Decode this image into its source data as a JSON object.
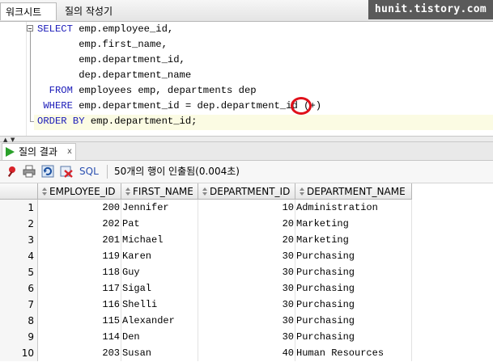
{
  "tabs": {
    "worksheet": "워크시트",
    "query_builder": "질의 작성기"
  },
  "watermark": "hunit.tistory.com",
  "editor": {
    "lines": [
      [
        {
          "t": "SELECT",
          "kw": true
        },
        {
          "t": " emp.employee_id,",
          "kw": false
        }
      ],
      [
        {
          "t": "       emp.first_name,",
          "kw": false
        }
      ],
      [
        {
          "t": "       emp.department_id,",
          "kw": false
        }
      ],
      [
        {
          "t": "       dep.department_name",
          "kw": false
        }
      ],
      [
        {
          "t": "  FROM",
          "kw": true
        },
        {
          "t": " employees emp, departments dep",
          "kw": false
        }
      ],
      [
        {
          "t": " WHERE",
          "kw": true
        },
        {
          "t": " emp.department_id = dep.department_id (+)",
          "kw": false
        }
      ],
      [
        {
          "t": "ORDER BY",
          "kw": true
        },
        {
          "t": " emp.department_id;",
          "kw": false
        }
      ]
    ]
  },
  "results_tab": {
    "label": "질의 결과",
    "close": "x"
  },
  "toolbar": {
    "sql_label": "SQL",
    "status": "50개의 행이 인출됨(0.004초)"
  },
  "grid": {
    "columns": [
      "EMPLOYEE_ID",
      "FIRST_NAME",
      "DEPARTMENT_ID",
      "DEPARTMENT_NAME"
    ],
    "rows": [
      {
        "n": "1",
        "employee_id": "200",
        "first_name": "Jennifer",
        "department_id": "10",
        "department_name": "Administration"
      },
      {
        "n": "2",
        "employee_id": "202",
        "first_name": "Pat",
        "department_id": "20",
        "department_name": "Marketing"
      },
      {
        "n": "3",
        "employee_id": "201",
        "first_name": "Michael",
        "department_id": "20",
        "department_name": "Marketing"
      },
      {
        "n": "4",
        "employee_id": "119",
        "first_name": "Karen",
        "department_id": "30",
        "department_name": "Purchasing"
      },
      {
        "n": "5",
        "employee_id": "118",
        "first_name": "Guy",
        "department_id": "30",
        "department_name": "Purchasing"
      },
      {
        "n": "6",
        "employee_id": "117",
        "first_name": "Sigal",
        "department_id": "30",
        "department_name": "Purchasing"
      },
      {
        "n": "7",
        "employee_id": "116",
        "first_name": "Shelli",
        "department_id": "30",
        "department_name": "Purchasing"
      },
      {
        "n": "8",
        "employee_id": "115",
        "first_name": "Alexander",
        "department_id": "30",
        "department_name": "Purchasing"
      },
      {
        "n": "9",
        "employee_id": "114",
        "first_name": "Den",
        "department_id": "30",
        "department_name": "Purchasing"
      },
      {
        "n": "10",
        "employee_id": "203",
        "first_name": "Susan",
        "department_id": "40",
        "department_name": "Human Resources"
      }
    ]
  },
  "colors": {
    "keyword": "#1a1ab8",
    "highlight_circle": "#e0101a",
    "run_icon": "#2aa02a",
    "sql_link": "#2a4fb0"
  }
}
